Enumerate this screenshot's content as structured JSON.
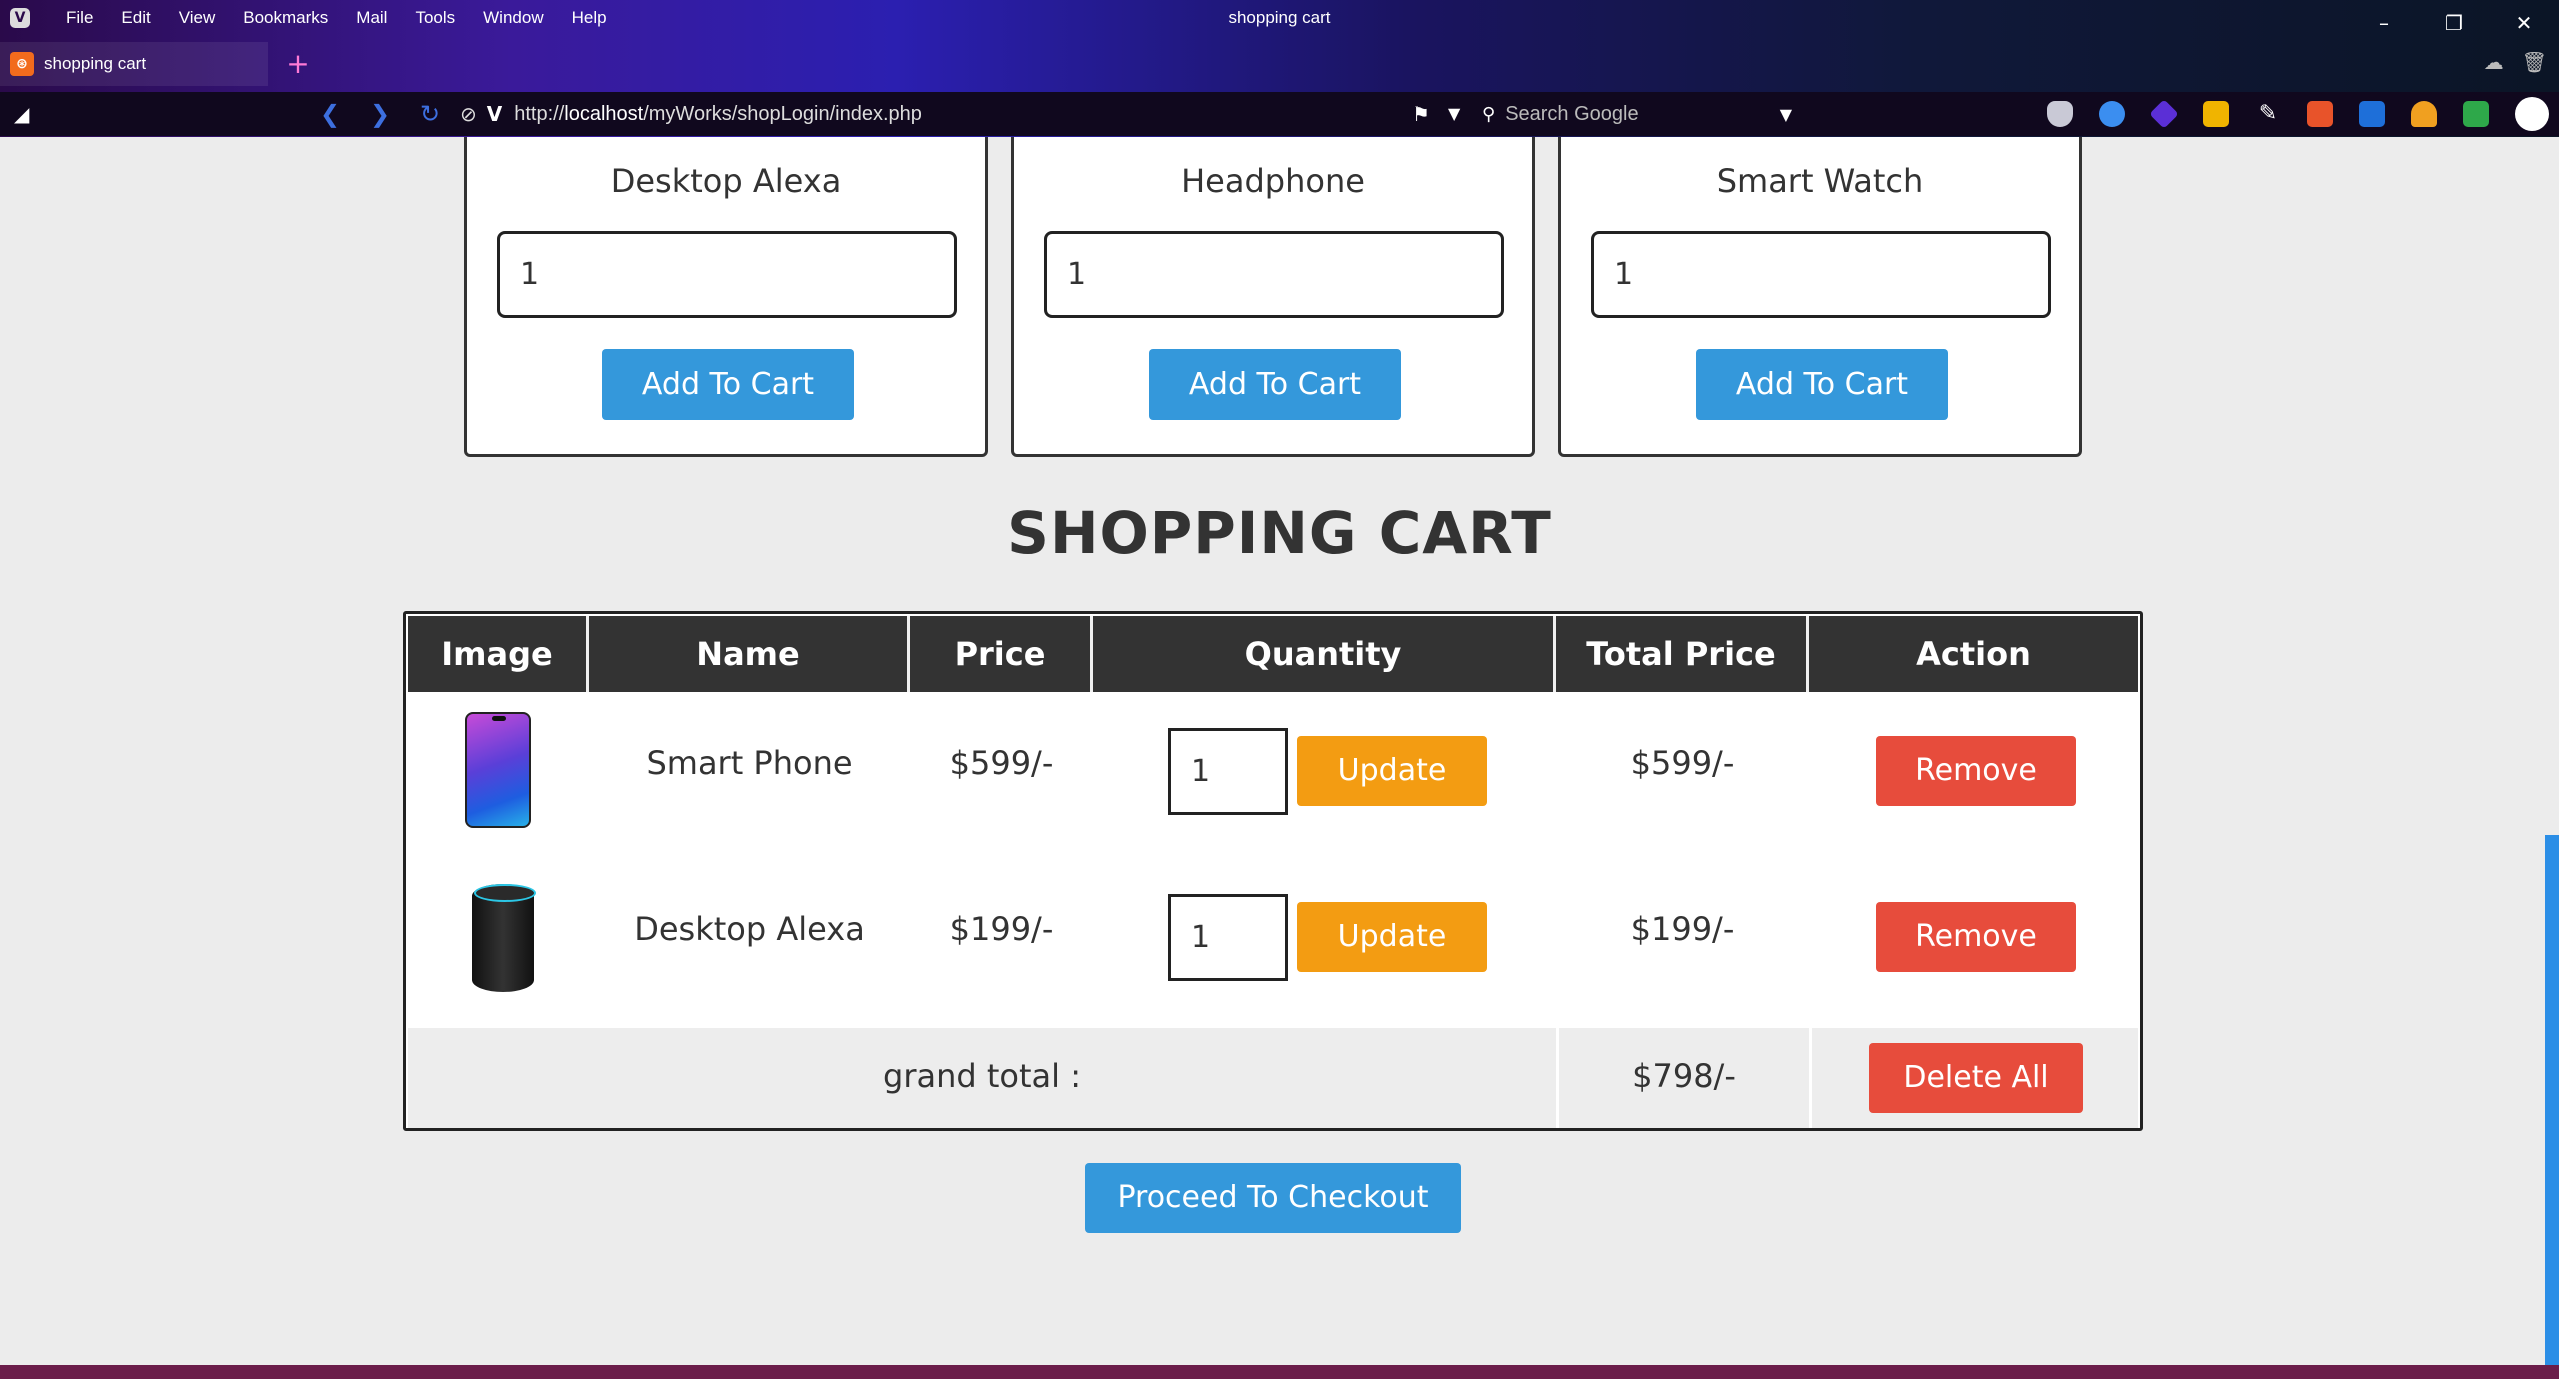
{
  "browser": {
    "window_title": "shopping cart",
    "menu": [
      "File",
      "Edit",
      "View",
      "Bookmarks",
      "Mail",
      "Tools",
      "Window",
      "Help"
    ],
    "tab_label": "shopping cart",
    "url_prefix": "http://",
    "url_host": "localhost",
    "url_path": "/myWorks/shopLogin/index.php",
    "search_placeholder": "Search Google"
  },
  "products": [
    {
      "name": "Desktop Alexa",
      "qty": "1",
      "button": "Add To Cart"
    },
    {
      "name": "Headphone",
      "qty": "1",
      "button": "Add To Cart"
    },
    {
      "name": "Smart Watch",
      "qty": "1",
      "button": "Add To Cart"
    }
  ],
  "cart": {
    "heading": "SHOPPING CART",
    "columns": [
      "Image",
      "Name",
      "Price",
      "Quantity",
      "Total Price",
      "Action"
    ],
    "rows": [
      {
        "image": "smart-phone-image",
        "name": "Smart Phone",
        "price": "$599/-",
        "qty": "1",
        "update": "Update",
        "total": "$599/-",
        "action": "Remove"
      },
      {
        "image": "desktop-alexa-image",
        "name": "Desktop Alexa",
        "price": "$199/-",
        "qty": "1",
        "update": "Update",
        "total": "$199/-",
        "action": "Remove"
      }
    ],
    "grand_total_label": "grand total :",
    "grand_total_value": "$798/-",
    "delete_all": "Delete All",
    "checkout": "Proceed To Checkout"
  },
  "colors": {
    "primary_button": "#3498db",
    "update_button": "#f39c12",
    "remove_button": "#e74c3c",
    "table_header": "#333333"
  }
}
